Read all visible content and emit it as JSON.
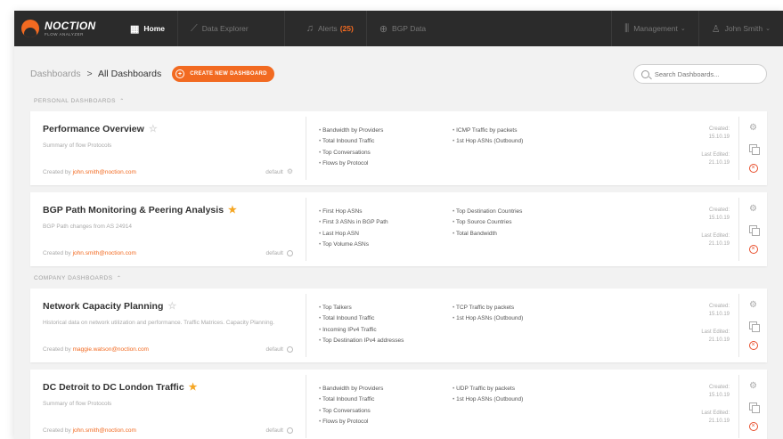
{
  "nav": {
    "logo_name": "NOCTION",
    "logo_sub": "FLOW ANALYZER",
    "home": "Home",
    "data_explorer": "Data Explorer",
    "alerts": "Alerts",
    "alerts_count": "(25)",
    "bgp_data": "BGP Data",
    "management": "Management",
    "user": "John Smith"
  },
  "toolbar": {
    "breadcrumb_root": "Dashboards",
    "breadcrumb_sep": ">",
    "breadcrumb_current": "All Dashboards",
    "create_label": "CREATE NEW DASHBOARD",
    "search_placeholder": "Search Dashboards..."
  },
  "sections": {
    "personal": "PERSONAL DASHBOARDS",
    "company": "COMPANY DASHBOARDS"
  },
  "labels": {
    "created_by": "Created by",
    "default": "default",
    "created": "Created:",
    "last_edited": "Last Edited:"
  },
  "dashboards": [
    {
      "title": "Performance Overview",
      "starred": false,
      "desc": "Summary of flow Protocols",
      "email": "john.smith@noction.com",
      "widgets_a": [
        "Bandwidth by Providers",
        "Total Inbound Traffic",
        "Top Conversations",
        "Flows by Protocol"
      ],
      "widgets_b": [
        "ICMP Traffic by packets",
        "1st Hop ASNs (Outbound)"
      ],
      "created": "15.10.19",
      "edited": "21.10.19"
    },
    {
      "title": "BGP Path Monitoring & Peering Analysis",
      "starred": true,
      "desc": "BGP Path changes from AS 24914",
      "email": "john.smith@noction.com",
      "widgets_a": [
        "First Hop ASNs",
        "First 3 ASNs in BGP Path",
        "Last Hop ASN",
        "Top Volume ASNs"
      ],
      "widgets_b": [
        "Top Destination Countries",
        "Top Source Countries",
        "Total Bandwidth"
      ],
      "created": "15.10.19",
      "edited": "21.10.19"
    },
    {
      "title": "Network Capacity Planning",
      "starred": false,
      "desc": "Historical data on network utilization and performance. Traffic Matrices. Capacity Planning.",
      "email": "maggie.watson@noction.com",
      "widgets_a": [
        "Top Talkers",
        "Total Inbound Traffic",
        "Incoming IPv4 Traffic",
        "Top Destination IPv4 addresses"
      ],
      "widgets_b": [
        "TCP Traffic by packets",
        "1st Hop ASNs (Outbound)"
      ],
      "created": "15.10.19",
      "edited": "21.10.19"
    },
    {
      "title": "DC Detroit to DC London Traffic",
      "starred": true,
      "desc": "Summary of flow Protocols",
      "email": "john.smith@noction.com",
      "widgets_a": [
        "Bandwidth by Providers",
        "Total Inbound Traffic",
        "Top Conversations",
        "Flows by Protocol"
      ],
      "widgets_b": [
        "UDP Traffic by packets",
        "1st Hop ASNs (Outbound)"
      ],
      "created": "15.10.19",
      "edited": "21.10.19"
    }
  ],
  "colors": {
    "accent": "#f26a21",
    "star": "#f5a623",
    "nav_bg": "#2b2b2b",
    "delete": "#e8502e"
  }
}
